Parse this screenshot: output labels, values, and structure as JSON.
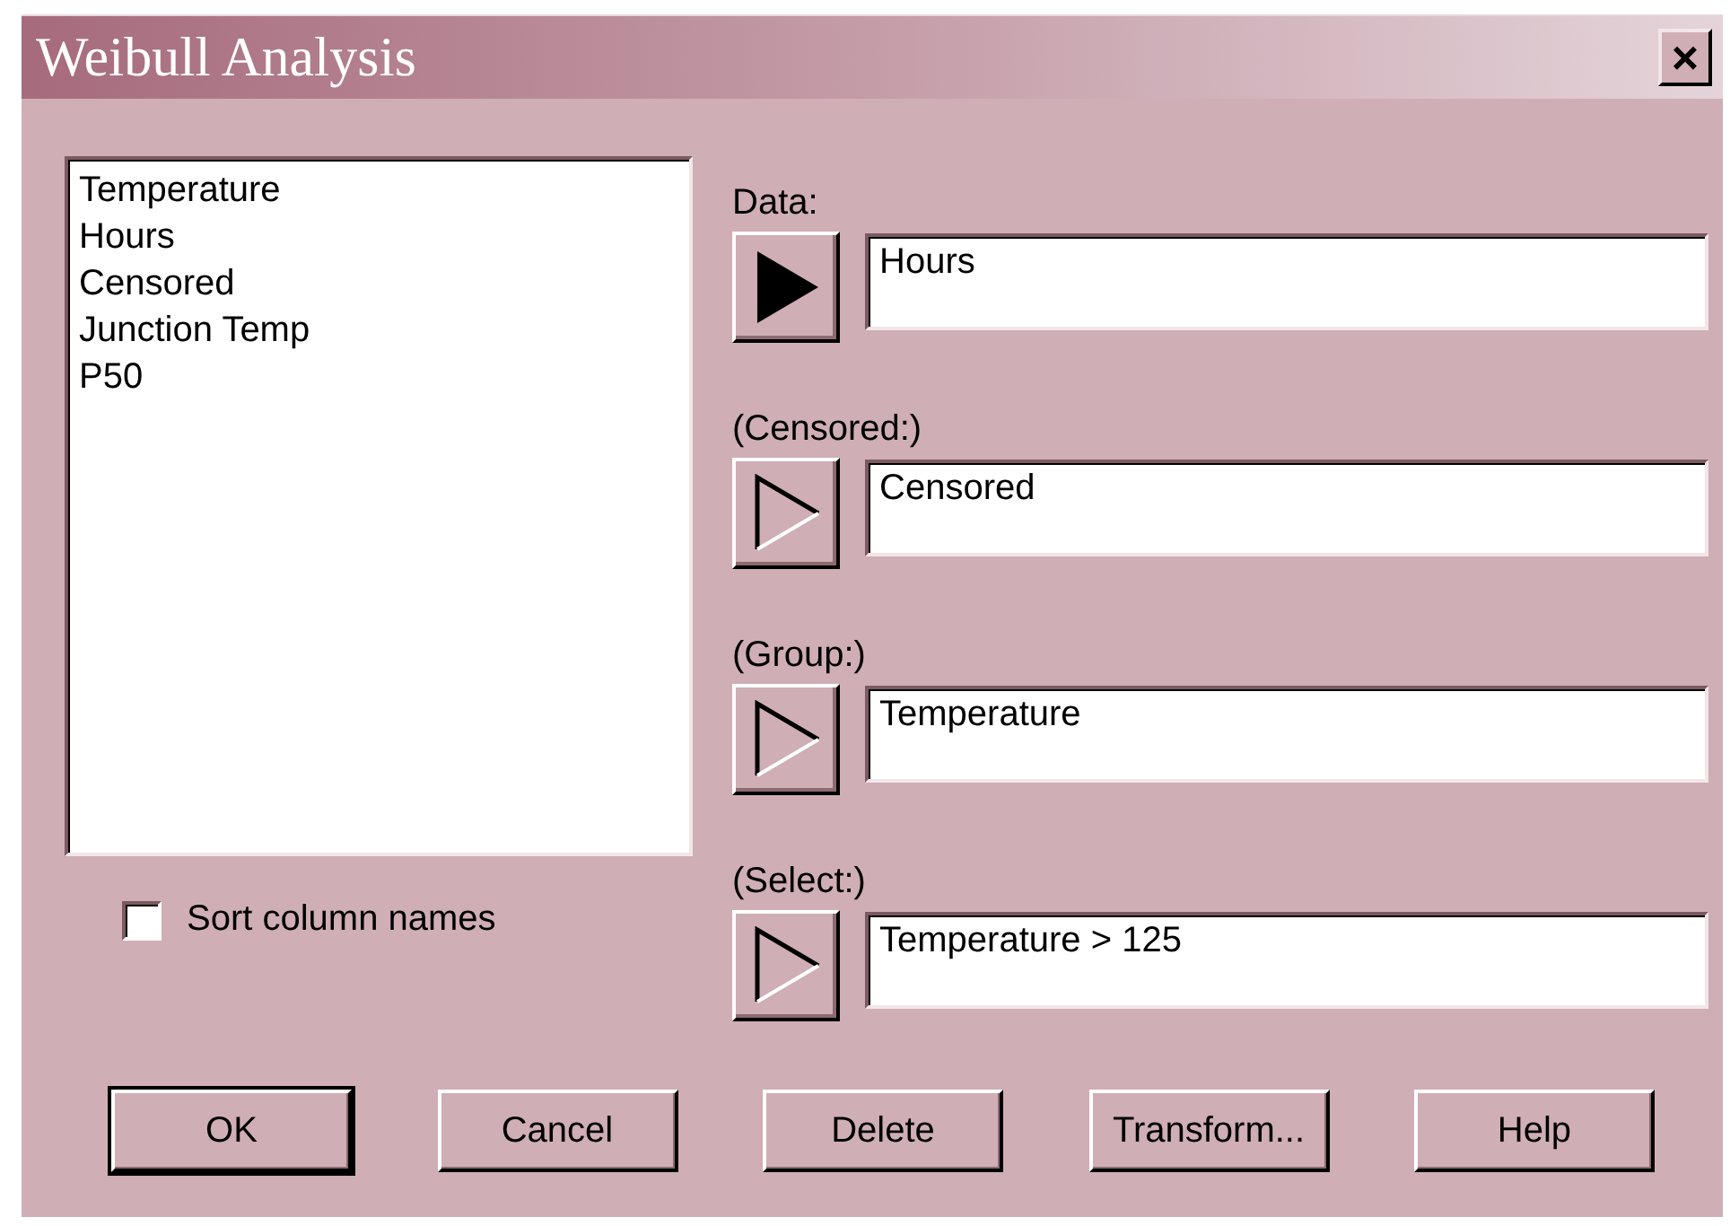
{
  "window": {
    "title": "Weibull Analysis",
    "close": "×"
  },
  "columns_list": [
    "Temperature",
    "Hours",
    "Censored",
    "Junction Temp",
    "P50"
  ],
  "sort_column_names": {
    "label": "Sort column names",
    "checked": false
  },
  "fields": [
    {
      "label": "Data:",
      "value": "Hours",
      "selected": true
    },
    {
      "label": "(Censored:)",
      "value": "Censored",
      "selected": false
    },
    {
      "label": "(Group:)",
      "value": "Temperature",
      "selected": false
    },
    {
      "label": "(Select:)",
      "value": "Temperature > 125",
      "selected": false
    }
  ],
  "buttons": [
    {
      "label": "OK",
      "default": true
    },
    {
      "label": "Cancel",
      "default": false
    },
    {
      "label": "Delete",
      "default": false
    },
    {
      "label": "Transform...",
      "default": false
    },
    {
      "label": "Help",
      "default": false
    }
  ]
}
